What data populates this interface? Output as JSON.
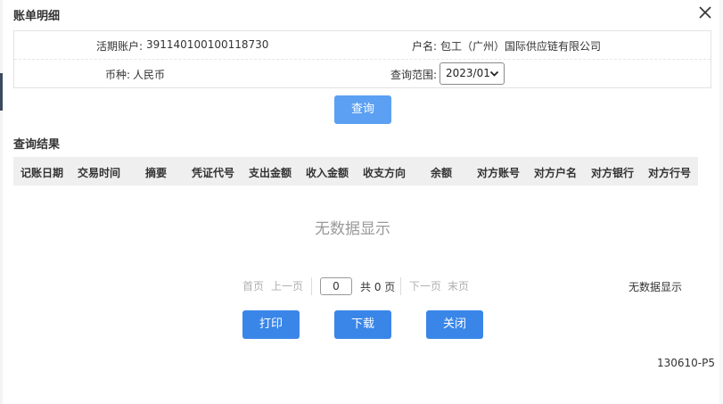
{
  "dialog": {
    "title": "账单明细"
  },
  "info": {
    "account_label": "活期账户:",
    "account_value": "391140100100118730",
    "name_label": "户名:",
    "name_value": "包工（广州）国际供应链有限公司",
    "currency_label": "币种:",
    "currency_value": "人民币",
    "range_label": "查询范围:",
    "range_value": "2023/01"
  },
  "query_button": "查询",
  "results": {
    "title": "查询结果",
    "columns": [
      "记账日期",
      "交易时间",
      "摘要",
      "凭证代号",
      "支出金额",
      "收入金额",
      "收支方向",
      "余额",
      "对方账号",
      "对方户名",
      "对方银行",
      "对方行号"
    ],
    "empty_text": "无数据显示"
  },
  "pager": {
    "first": "首页",
    "prev": "上一页",
    "page_value": "0",
    "total": "共 0 页",
    "next": "下一页",
    "last": "末页",
    "status": "无数据显示"
  },
  "actions": {
    "print": "打印",
    "download": "下载",
    "close": "关闭"
  },
  "page_code": "130610-P5",
  "colors": {
    "primary": "#3a86e8",
    "primary_light": "#5ba0f2",
    "header_bg": "#efefef"
  }
}
